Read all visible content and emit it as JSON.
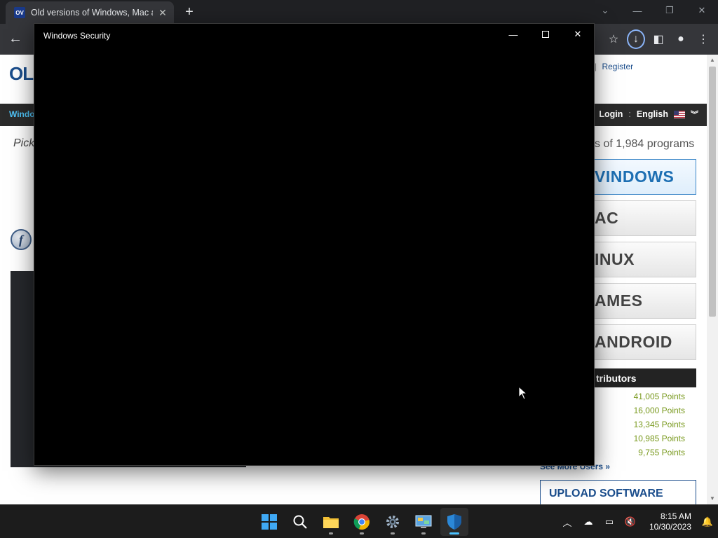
{
  "browser": {
    "tab_title": "Old versions of Windows, Mac a",
    "favicon_text": "OV",
    "new_tab_label": "+",
    "tab_close_label": "✕"
  },
  "page": {
    "logo": "OL",
    "register_sep": "|",
    "register": "Register",
    "nav_windows": "Windo",
    "login": "Login",
    "colon": ":",
    "language": "English",
    "pick_text": "Pick",
    "programs_text": "s of 1,984 programs",
    "os_buttons": [
      "VINDOWS",
      "AC",
      "INUX",
      "AMES",
      "ANDROID"
    ],
    "contributors_title": "tributors",
    "points": [
      "41,005 Points",
      "16,000 Points",
      "13,345 Points",
      "10,985 Points",
      "9,755 Points"
    ],
    "see_more": "See More Users »",
    "upload": "UPLOAD SOFTWARE"
  },
  "security_window": {
    "title": "Windows Security"
  },
  "taskbar": {
    "time": "8:15 AM",
    "date": "10/30/2023"
  },
  "colors": {
    "accent": "#4cc2ff",
    "link": "#1a4d8c",
    "points": "#7a9a1f"
  }
}
